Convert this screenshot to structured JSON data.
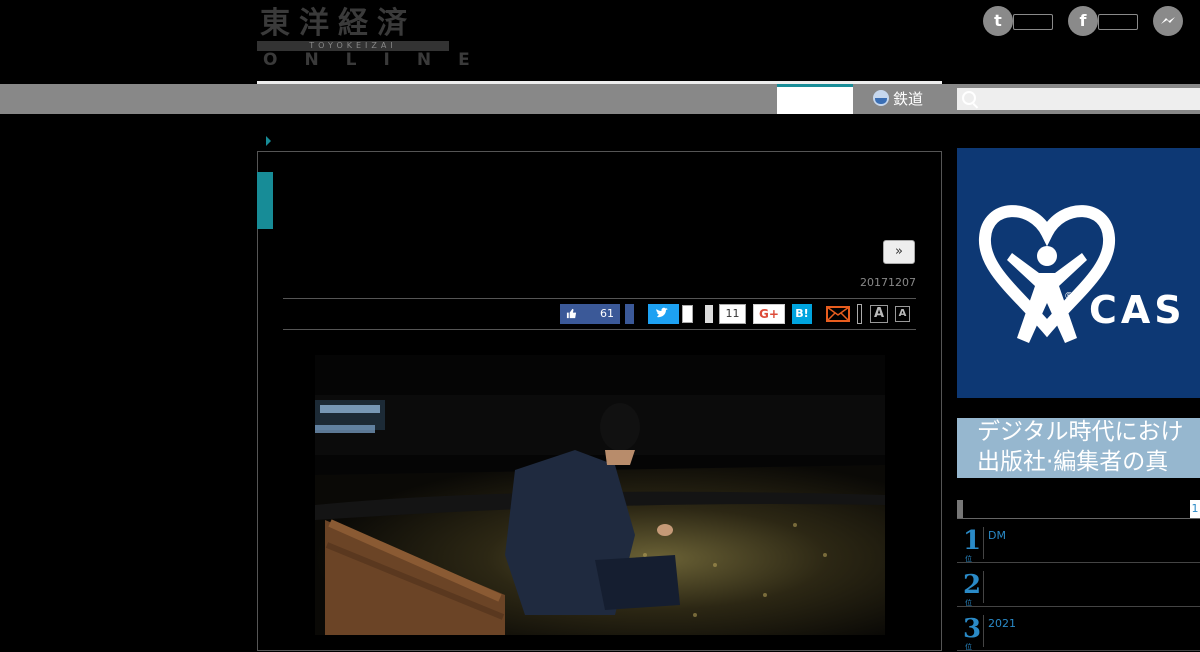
{
  "header": {
    "logo_jp": "東洋経済",
    "logo_band": "TOYOKEIZAI",
    "logo_en": "ONLINE",
    "social": [
      {
        "icon": "twitter-icon",
        "glyph": "t"
      },
      {
        "icon": "facebook-icon",
        "glyph": "f"
      },
      {
        "icon": "messenger-icon",
        "glyph": "m"
      }
    ]
  },
  "nav": {
    "rail_label": "鉄道",
    "search_placeholder": ""
  },
  "article": {
    "more_label": "»",
    "date": "20171207",
    "share": {
      "facebook_count": "61",
      "hatena_count": "11",
      "gplus_label": "G+",
      "hatena_label": "B!",
      "font_large": "A",
      "font_small": "A"
    }
  },
  "sidebar": {
    "ad_cas_text": "CAS",
    "ad_cas_reg": "®",
    "ad_pub_line1": "デジタル時代におけ",
    "ad_pub_line2": "出版社·編集者の真",
    "ranking_tab": "1",
    "ranking": [
      {
        "rank": "1",
        "suffix": "位",
        "text": "DM"
      },
      {
        "rank": "2",
        "suffix": "位",
        "text": ""
      },
      {
        "rank": "3",
        "suffix": "位",
        "text": "2021"
      }
    ]
  },
  "colors": {
    "accent": "#178c97",
    "facebook": "#3b5998",
    "twitter": "#1da1f2",
    "hatena": "#00a4de",
    "cas_blue": "#0d3874",
    "rank_blue": "#2a8ac7"
  }
}
